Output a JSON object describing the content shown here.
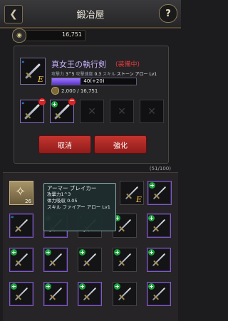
{
  "header": {
    "title": "鍛冶屋",
    "help": "?"
  },
  "currency": {
    "gold": "16,751"
  },
  "weapon": {
    "name": "真女王の執行剣",
    "equip_state": "(装備中)",
    "stats_prefix": "攻撃力",
    "attack": "3^5",
    "speed_label": "攻撃速度",
    "speed": "0.3",
    "skill_label": "スキル",
    "skill": "ストーン アロー Lv1",
    "rank": "E",
    "exp_text": "40(+20)",
    "exp_fraction": 0.34,
    "cost": "2,000 / 16,751"
  },
  "buttons": {
    "cancel": "取消",
    "enhance": "強化"
  },
  "inventory": {
    "count": "(51/100)",
    "material_count": "26",
    "equipped_rank": "E"
  },
  "tooltip": {
    "name": "アーマー ブレイカー",
    "line1": "攻撃力1^3",
    "line2": "体力吸収 0.05",
    "line3": "スキル ファイアー アロー Lv1"
  },
  "colors": {
    "accent": "#c5342f",
    "rare": "#7e5ac4",
    "epic_text": "#c9b3ff"
  }
}
